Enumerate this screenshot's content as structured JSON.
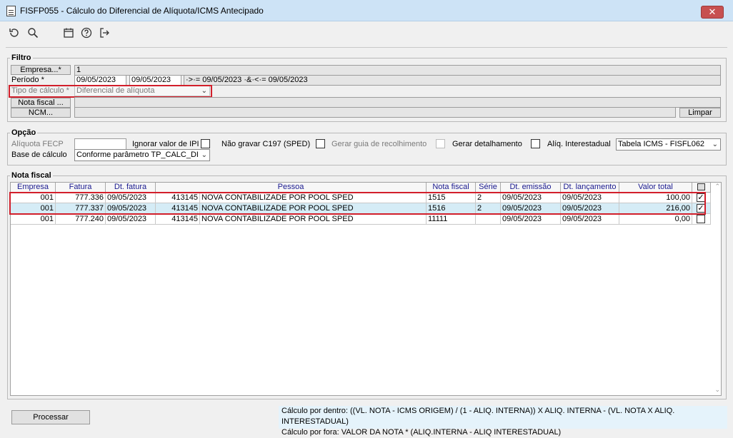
{
  "window": {
    "title": "FISFP055 - Cálculo do Diferencial de Alíquota/ICMS Antecipado",
    "close_label": "✕"
  },
  "toolbar": {
    "icons": [
      "refresh-icon",
      "search-icon",
      "calendar-icon",
      "help-icon",
      "exit-icon"
    ]
  },
  "filtro": {
    "legend": "Filtro",
    "empresa_button": "Empresa...*",
    "empresa_value": "1",
    "periodo_label": "Período *",
    "periodo_start": "09/05/2023",
    "periodo_end": "09/05/2023",
    "periodo_desc": "·>·= 09/05/2023 ·&·<·= 09/05/2023",
    "tipo_calculo_label": "Tipo de cálculo *",
    "tipo_calculo_value": "Diferencial de alíquota",
    "nota_fiscal_button": "Nota fiscal ...",
    "ncm_button": "NCM...",
    "limpar_button": "Limpar"
  },
  "opcao": {
    "legend": "Opção",
    "aliquota_fecp_label": "Alíquota FECP",
    "ignorar_ipi_label": "Ignorar valor de IPI",
    "nao_gravar_label": "Não gravar C197 (SPED)",
    "gerar_guia_label": "Gerar guia de recolhimento",
    "gerar_detalhamento_label": "Gerar detalhamento",
    "aliq_interestadual_label": "Alíq. Interestadual",
    "aliq_interestadual_value": "Tabela ICMS - FISFL062",
    "base_calculo_label": "Base de cálculo",
    "base_calculo_value": "Conforme parâmetro TP_CALC_DIF"
  },
  "nota_fiscal": {
    "legend": "Nota fiscal",
    "columns": [
      "Empresa",
      "Fatura",
      "Dt. fatura",
      "Pessoa",
      "Nota fiscal",
      "Série",
      "Dt. emissão",
      "Dt. lançamento",
      "Valor total",
      ""
    ],
    "rows": [
      {
        "empresa": "001",
        "fatura": "777.336",
        "dt_fatura": "09/05/2023",
        "pessoa_cod": "413145",
        "pessoa_nome": "NOVA CONTABILIZADE POR POOL SPED",
        "nota": "1515",
        "serie": "2",
        "dt_emissao": "09/05/2023",
        "dt_lancamento": "09/05/2023",
        "valor": "100,00",
        "checked": "✓",
        "selected": false
      },
      {
        "empresa": "001",
        "fatura": "777.337",
        "dt_fatura": "09/05/2023",
        "pessoa_cod": "413145",
        "pessoa_nome": "NOVA CONTABILIZADE POR POOL SPED",
        "nota": "1516",
        "serie": "2",
        "dt_emissao": "09/05/2023",
        "dt_lancamento": "09/05/2023",
        "valor": "216,00",
        "checked": "✓",
        "selected": true
      },
      {
        "empresa": "001",
        "fatura": "777.240",
        "dt_fatura": "09/05/2023",
        "pessoa_cod": "413145",
        "pessoa_nome": "NOVA CONTABILIZADE POR POOL SPED",
        "nota": "11111",
        "serie": "",
        "dt_emissao": "09/05/2023",
        "dt_lancamento": "09/05/2023",
        "valor": "0,00",
        "checked": "",
        "selected": false
      }
    ]
  },
  "footer": {
    "processar_button": "Processar",
    "calc_dentro": "Cálculo por dentro: ((VL. NOTA - ICMS ORIGEM) / (1 - ALIQ. INTERNA)) X ALIQ. INTERNA - (VL. NOTA X ALIQ. INTERESTADUAL)",
    "calc_fora": "Cálculo por fora: VALOR DA NOTA * (ALIQ.INTERNA - ALIQ INTERESTADUAL)"
  },
  "colors": {
    "highlight_border": "#d21f2b",
    "selected_row": "#d5ecf6",
    "header_text": "#1a1a8f"
  }
}
